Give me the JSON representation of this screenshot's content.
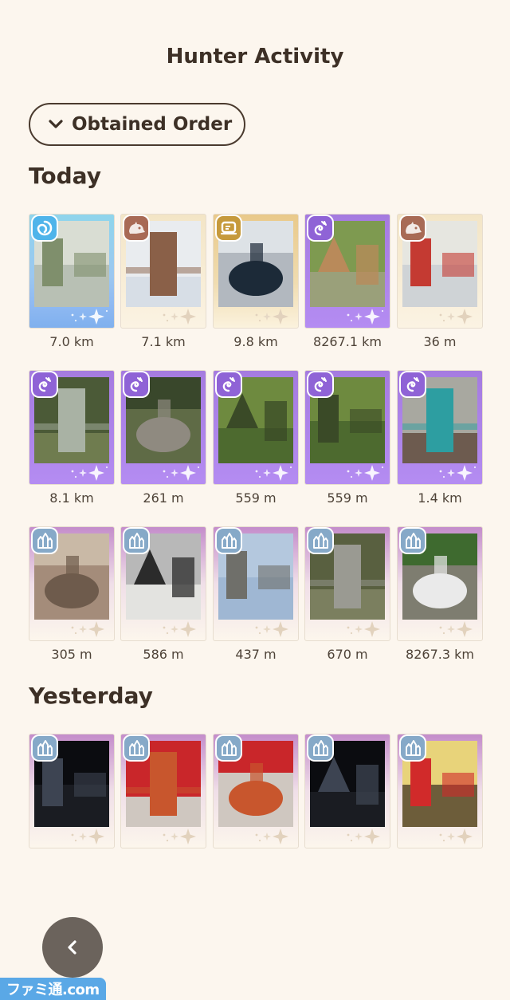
{
  "page": {
    "title": "Hunter Activity"
  },
  "sort": {
    "label": "Obtained Order",
    "icon": "chevron-down-icon"
  },
  "sections": [
    {
      "title": "Today",
      "cards": [
        {
          "distance": "7.0 km",
          "frame": "blue",
          "badge": "swirl"
        },
        {
          "distance": "7.1 km",
          "frame": "cream",
          "badge": "creature"
        },
        {
          "distance": "9.8 km",
          "frame": "gold",
          "badge": "box"
        },
        {
          "distance": "8267.1 km",
          "frame": "purple",
          "badge": "spiral"
        },
        {
          "distance": "36 m",
          "frame": "cream",
          "badge": "creature"
        },
        {
          "distance": "8.1 km",
          "frame": "purple",
          "badge": "spiral"
        },
        {
          "distance": "261 m",
          "frame": "purple",
          "badge": "spiral"
        },
        {
          "distance": "559 m",
          "frame": "purple",
          "badge": "spiral"
        },
        {
          "distance": "559 m",
          "frame": "purple",
          "badge": "spiral"
        },
        {
          "distance": "1.4 km",
          "frame": "purple",
          "badge": "spiral"
        },
        {
          "distance": "305 m",
          "frame": "pink",
          "badge": "crystal"
        },
        {
          "distance": "586 m",
          "frame": "pink",
          "badge": "crystal"
        },
        {
          "distance": "437 m",
          "frame": "pink",
          "badge": "crystal"
        },
        {
          "distance": "670 m",
          "frame": "pink",
          "badge": "crystal"
        },
        {
          "distance": "8267.3 km",
          "frame": "pink",
          "badge": "crystal"
        }
      ]
    },
    {
      "title": "Yesterday",
      "cards": [
        {
          "distance": "",
          "frame": "pink",
          "badge": "crystal"
        },
        {
          "distance": "",
          "frame": "pink",
          "badge": "crystal"
        },
        {
          "distance": "",
          "frame": "pink",
          "badge": "crystal"
        },
        {
          "distance": "",
          "frame": "pink",
          "badge": "crystal"
        },
        {
          "distance": "",
          "frame": "pink",
          "badge": "crystal"
        }
      ]
    }
  ],
  "back": {
    "icon": "chevron-left-icon"
  },
  "watermark": {
    "text": "ファミ通.com"
  },
  "colors": {
    "background": "#fcf6ee",
    "text": "#3d3026",
    "purple_frame": "#a57be0",
    "blue_frame": "#8fb9f2",
    "back_button": "#6b635c"
  }
}
